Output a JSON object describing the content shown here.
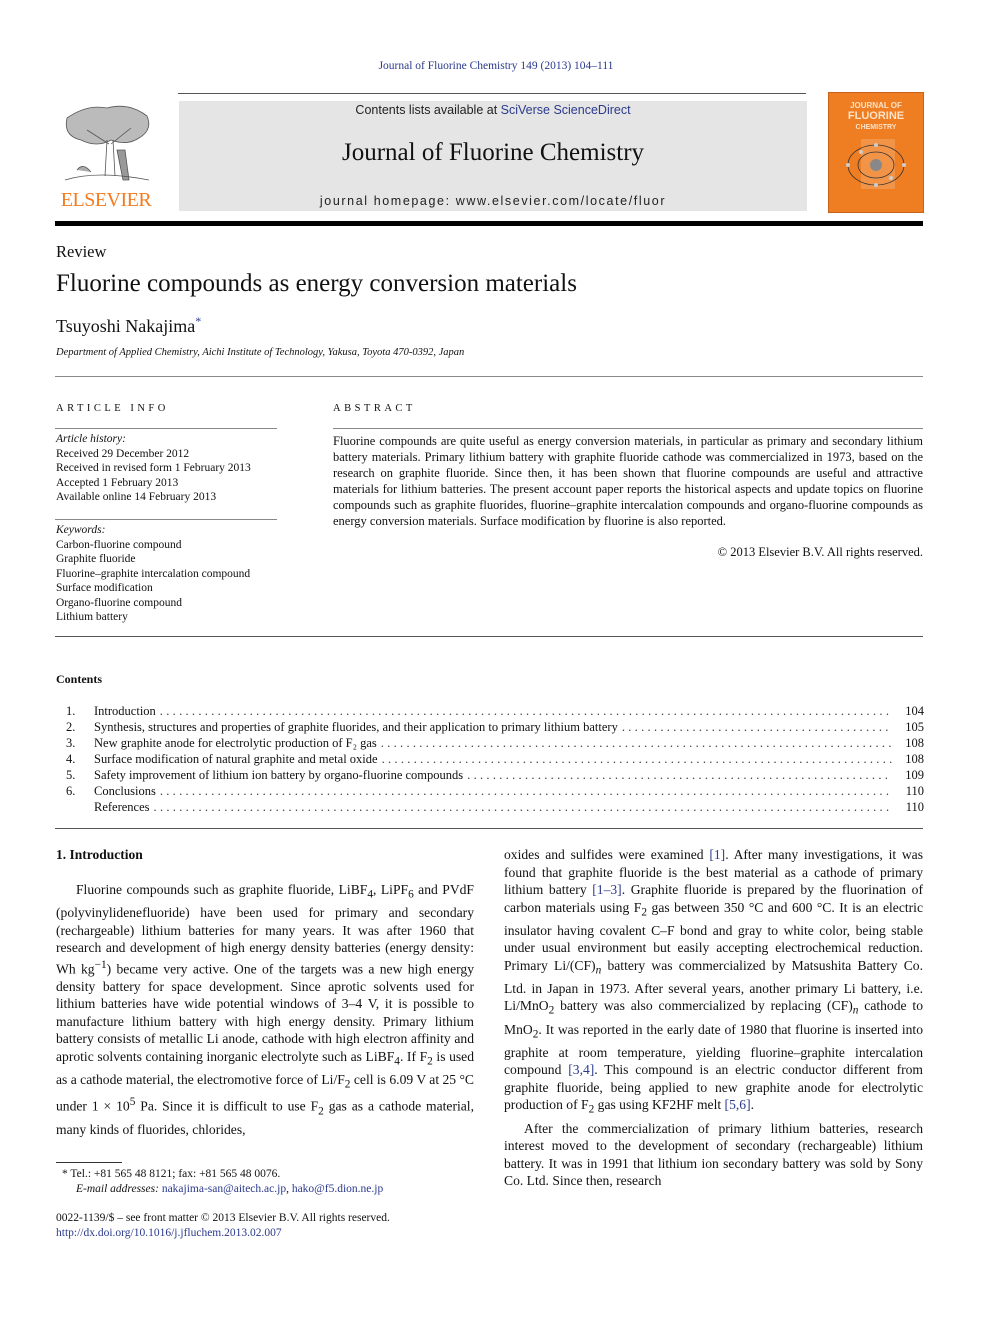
{
  "header": {
    "citation": "Journal of Fluorine Chemistry 149 (2013) 104–111",
    "contents_prefix": "Contents lists available at ",
    "contents_link": "SciVerse ScienceDirect",
    "journal_title": "Journal of Fluorine Chemistry",
    "homepage": "journal homepage: www.elsevier.com/locate/fluor",
    "publisher_logo": "ELSEVIER",
    "cover": {
      "line1": "JOURNAL OF",
      "line2": "FLUORINE",
      "line3": "CHEMISTRY"
    },
    "colors": {
      "link": "#2b3a8c",
      "elsevier_orange": "#f47b20",
      "cover_orange": "#ef7d22"
    }
  },
  "article": {
    "type": "Review",
    "title": "Fluorine compounds as energy conversion materials",
    "author": "Tsuyoshi Nakajima",
    "author_mark": "*",
    "affiliation": "Department of Applied Chemistry, Aichi Institute of Technology, Yakusa, Toyota 470-0392, Japan"
  },
  "article_info": {
    "heading": "ARTICLE INFO",
    "history_label": "Article history:",
    "history": [
      "Received 29 December 2012",
      "Received in revised form 1 February 2013",
      "Accepted 1 February 2013",
      "Available online 14 February 2013"
    ],
    "keywords_label": "Keywords:",
    "keywords": [
      "Carbon-fluorine compound",
      "Graphite fluoride",
      "Fluorine–graphite intercalation compound",
      "Surface modification",
      "Organo-fluorine compound",
      "Lithium battery"
    ]
  },
  "abstract": {
    "heading": "ABSTRACT",
    "text": "Fluorine compounds are quite useful as energy conversion materials, in particular as primary and secondary lithium battery materials. Primary lithium battery with graphite fluoride cathode was commercialized in 1973, based on the research on graphite fluoride. Since then, it has been shown that fluorine compounds are useful and attractive materials for lithium batteries. The present account paper reports the historical aspects and update topics on fluorine compounds such as graphite fluorides, fluorine–graphite intercalation compounds and organo-fluorine compounds as energy conversion materials. Surface modification by fluorine is also reported.",
    "copyright": "© 2013 Elsevier B.V. All rights reserved."
  },
  "contents": {
    "heading": "Contents",
    "items": [
      {
        "num": "1.",
        "label": "Introduction",
        "page": "104"
      },
      {
        "num": "2.",
        "label": "Synthesis, structures and properties of graphite fluorides, and their application to primary lithium battery",
        "page": "105"
      },
      {
        "num": "3.",
        "label": "New graphite anode for electrolytic production of F₂ gas",
        "page": "108"
      },
      {
        "num": "4.",
        "label": "Surface modification of natural graphite and metal oxide",
        "page": "108"
      },
      {
        "num": "5.",
        "label": "Safety improvement of lithium ion battery by organo-fluorine compounds",
        "page": "109"
      },
      {
        "num": "6.",
        "label": "Conclusions",
        "page": "110"
      },
      {
        "num": "",
        "label": "References",
        "page": "110"
      }
    ]
  },
  "body": {
    "section_heading": "1.  Introduction",
    "left": {
      "p1a": "Fluorine compounds such as graphite fluoride, LiBF",
      "p1b": ", LiPF",
      "p1c": " and PVdF (polyvinylidenefluoride) have been used for primary and secondary (rechargeable) lithium batteries for many years. It was after 1960 that research and development of high energy density batteries (energy density: Wh kg",
      "p1d": ") became very active. One of the targets was a new high energy density battery for space development. Since aprotic solvents used for lithium batteries have wide potential windows of 3–4 V, it is possible to manufacture lithium battery with high energy density. Primary lithium battery consists of metallic Li anode, cathode with high electron affinity and aprotic solvents containing inorganic electrolyte such as LiBF",
      "p1e": ". If F",
      "p1f": " is used as a cathode material, the electromotive force of Li/F",
      "p1g": " cell is 6.09 V at 25 °C under 1 × 10",
      "p1h": " Pa. Since it is difficult to use F",
      "p1i": " gas as a cathode material, many kinds of fluorides, chlorides,"
    },
    "right": {
      "p1a": "oxides and sulfides were examined ",
      "ref1": "[1]",
      "p1b": ". After many investigations, it was found that graphite fluoride is the best material as a cathode of primary lithium battery ",
      "ref2": "[1–3]",
      "p1c": ". Graphite fluoride is prepared by the fluorination of carbon materials using F",
      "p1d": " gas between 350 °C and 600 °C. It is an electric insulator having covalent C–F bond and gray to white color, being stable under usual environment but easily accepting electrochemical reduction. Primary Li/(CF)",
      "p1e": " battery was commercialized by Matsushita Battery Co. Ltd. in Japan in 1973. After several years, another primary Li battery, i.e. Li/MnO",
      "p1f": " battery was also commercialized by replacing (CF)",
      "p1g": " cathode to MnO",
      "p1h": ". It was reported in the early date of 1980 that fluorine is inserted into graphite at room temperature, yielding fluorine–graphite intercalation compound ",
      "ref3": "[3,4]",
      "p1i": ". This compound is an electric conductor different from graphite fluoride, being applied to new graphite anode for electrolytic production of F",
      "p1j": " gas using KF2HF melt ",
      "ref4": "[5,6]",
      "p1k": ".",
      "p2": "After the commercialization of primary lithium batteries, research interest moved to the development of secondary (rechargeable) lithium battery. It was in 1991 that lithium ion secondary battery was sold by Sony Co. Ltd. Since then, research"
    },
    "subs": {
      "four": "4",
      "six": "6",
      "two": "2",
      "minus_one": "−1",
      "five": "5",
      "n": "n"
    }
  },
  "footnotes": {
    "contact": "* Tel.: +81 565 48 8121; fax: +81 565 48 0076.",
    "email_label": "E-mail addresses:",
    "email1": "nakajima-san@aitech.ac.jp",
    "email2": "hako@f5.dion.ne.jp",
    "issn": "0022-1139/$ – see front matter © 2013 Elsevier B.V. All rights reserved.",
    "doi": "http://dx.doi.org/10.1016/j.jfluchem.2013.02.007"
  }
}
